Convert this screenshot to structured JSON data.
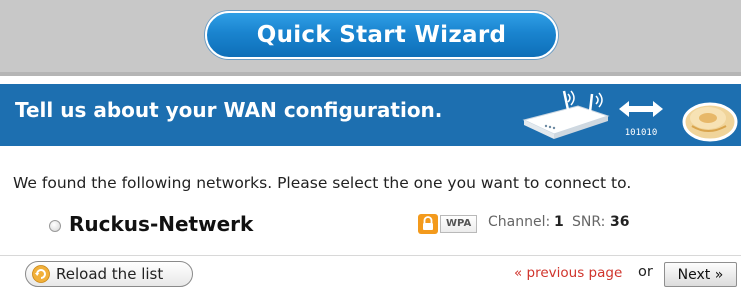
{
  "wizard": {
    "title": "Quick Start Wizard"
  },
  "header": {
    "title": "Tell us about your WAN configuration.",
    "binary_text": "101010"
  },
  "intro": {
    "text": "We found the following networks. Please select the one you want to connect to."
  },
  "networks": [
    {
      "name": "Ruckus-Netwerk",
      "security": "WPA",
      "channel_label": "Channel:",
      "channel": "1",
      "snr_label": "SNR:",
      "snr": "36",
      "selected": false
    }
  ],
  "footer": {
    "reload_label": "Reload the list",
    "prev_label": "« previous page",
    "or_text": "or",
    "next_label": "Next »"
  },
  "colors": {
    "header_blue": "#1d6fb0",
    "pill_blue": "#1a84cf",
    "link_red": "#d0342c",
    "lock_orange": "#f39a1c"
  },
  "icons": [
    "router-icon",
    "arrows-icon",
    "shield-icon",
    "lock-icon",
    "reload-icon"
  ]
}
